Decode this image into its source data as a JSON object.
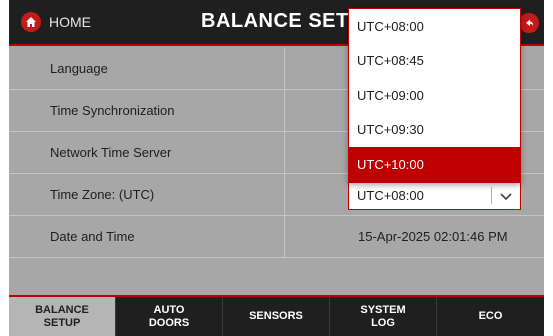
{
  "header": {
    "home_label": "HOME",
    "title": "BALANCE SETUP",
    "home_icon": "home-icon",
    "back_icon": "back-icon",
    "accent_color": "#c00000"
  },
  "settings": {
    "rows": [
      {
        "label": "Language",
        "value": ""
      },
      {
        "label": "Time Synchronization",
        "value": ""
      },
      {
        "label": "Network Time Server",
        "value": ""
      },
      {
        "label": "Time Zone: (UTC)",
        "value": "UTC+08:00"
      },
      {
        "label": "Date and Time",
        "value": "15-Apr-2025 02:01:46 PM"
      }
    ]
  },
  "timezone_dropdown": {
    "options": [
      "UTC+08:00",
      "UTC+08:45",
      "UTC+09:00",
      "UTC+09:30",
      "UTC+10:00"
    ],
    "highlighted": "UTC+10:00"
  },
  "tabs": [
    {
      "label": "BALANCE\nSETUP",
      "active": true
    },
    {
      "label": "AUTO\nDOORS",
      "active": false
    },
    {
      "label": "SENSORS",
      "active": false
    },
    {
      "label": "SYSTEM\nLOG",
      "active": false
    },
    {
      "label": "ECO",
      "active": false
    }
  ]
}
